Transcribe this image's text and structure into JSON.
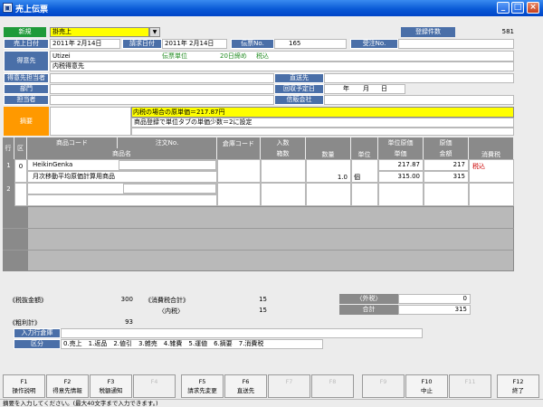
{
  "window": {
    "title": "売上伝票",
    "icon_glyph": "▣",
    "min": "_",
    "max": "□",
    "close": "×"
  },
  "colors": {
    "label_blue": "#4a6fa8",
    "header_grey": "#8a8a8a",
    "highlight_yellow": "#ffff00",
    "summary_orange": "#ff9900",
    "tax_red": "#cc0000"
  },
  "top": {
    "mode_label": "新規",
    "sale_type": "掛売上",
    "count_label": "登録件数",
    "count_value": "581",
    "sales_date_label": "売上日付",
    "sales_date": "2011年 2月14日",
    "bill_date_label": "請求日付",
    "bill_date": "2011年 2月14日",
    "slip_no_label": "伝票No.",
    "slip_no": "165",
    "order_no_label": "受注No.",
    "order_no": ""
  },
  "customer": {
    "label": "得意先",
    "code": "Utizei",
    "unit": "伝票単位",
    "closing": "20日締め",
    "tax_type": "税込",
    "name": "内税得意先",
    "contact_label": "得意先担当者",
    "contact": "",
    "ship_to_label": "直送先",
    "ship_to": "",
    "dept_label": "部門",
    "dept": "",
    "collect_label": "回収予定日",
    "collect_year": "年",
    "collect_month": "月",
    "collect_day": "日",
    "staff_label": "担当者",
    "staff": "",
    "consign_label": "信販会社",
    "consign": ""
  },
  "summary": {
    "label": "摘要",
    "line1": "内税の場合の原単価＝217.87円",
    "line2": "商品登録で単位タブの単価少数＝2に設定"
  },
  "grid": {
    "headers": {
      "row": "行",
      "kubun": "区",
      "code": "商品コード",
      "order_no": "注文No.",
      "name": "商品名",
      "warehouse": "倉庫コード",
      "irisu": "入数",
      "hakosu": "箱数",
      "qty": "数量",
      "unit": "単位",
      "cost_price": "単位原価",
      "unit_price": "単価",
      "cost": "原価",
      "amount": "金額",
      "tax": "消費税"
    },
    "rows": [
      {
        "no": "1",
        "kubun": "0",
        "code": "HeikinGenka",
        "name": "月次移動平均原価計算用商品",
        "qty": "1.0",
        "unit": "個",
        "cost_price": "217.87",
        "unit_price": "315.00",
        "cost": "217",
        "amount": "315",
        "tax": "税込"
      },
      {
        "no": "2",
        "kubun": "",
        "code": "",
        "name": "",
        "qty": "",
        "unit": "",
        "cost_price": "",
        "unit_price": "",
        "cost": "",
        "amount": "",
        "tax": ""
      }
    ]
  },
  "totals": {
    "gross_label": "《税抜金額》",
    "gross": "300",
    "tax_total_label": "《消費税合計》",
    "tax_total": "15",
    "inner_tax_label": "〈内税〉",
    "inner_tax": "15",
    "outer_tax_label": "〈外税〉",
    "outer_tax": "0",
    "sum_label": "合計",
    "sum": "315",
    "profit_label": "《粗利計》",
    "profit": "93"
  },
  "entry": {
    "warehouse_label": "入力行倉庫",
    "warehouse": "",
    "kubun_label": "区分",
    "kubun_list": "0.売上　1.返品　2.値引　3.雑売　4.雑費　5.運値　6.摘要　7.消費税"
  },
  "fkeys": [
    {
      "num": "F1",
      "label": "操作説明",
      "enabled": true
    },
    {
      "num": "F2",
      "label": "得意先情報",
      "enabled": true
    },
    {
      "num": "F3",
      "label": "税額通知",
      "enabled": true
    },
    {
      "num": "F4",
      "label": "",
      "enabled": false
    },
    {
      "num": "F5",
      "label": "請求先変更",
      "enabled": true
    },
    {
      "num": "F6",
      "label": "直送先",
      "enabled": true
    },
    {
      "num": "F7",
      "label": "",
      "enabled": false
    },
    {
      "num": "F8",
      "label": "",
      "enabled": false
    },
    {
      "num": "F9",
      "label": "",
      "enabled": false
    },
    {
      "num": "F10",
      "label": "中止",
      "enabled": true
    },
    {
      "num": "F11",
      "label": "",
      "enabled": false
    },
    {
      "num": "F12",
      "label": "終了",
      "enabled": true
    }
  ],
  "status": "摘要を入力してください。(最大40文字まで入力できます。)"
}
